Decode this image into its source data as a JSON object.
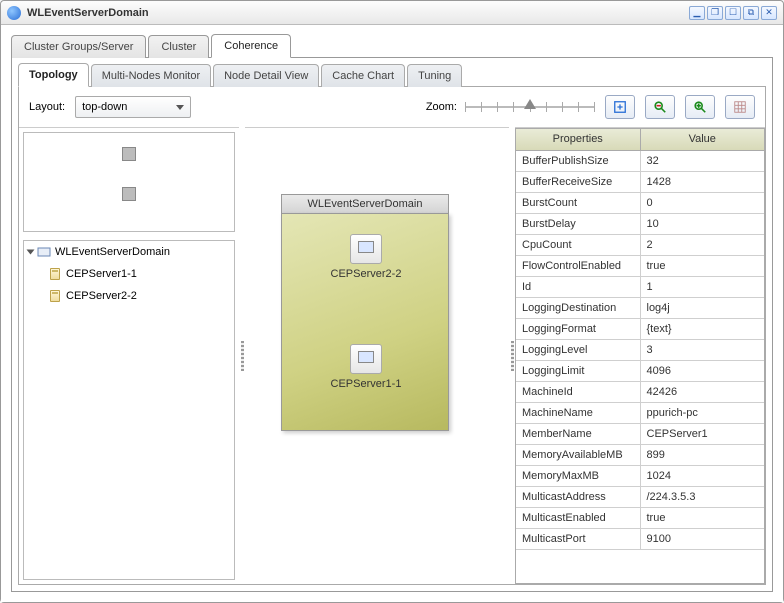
{
  "window": {
    "title": "WLEventServerDomain"
  },
  "primary_tabs": [
    {
      "label": "Cluster Groups/Server"
    },
    {
      "label": "Cluster"
    },
    {
      "label": "Coherence",
      "active": true
    }
  ],
  "sub_tabs": [
    {
      "label": "Topology",
      "active": true
    },
    {
      "label": "Multi-Nodes Monitor"
    },
    {
      "label": "Node Detail View"
    },
    {
      "label": "Cache Chart"
    },
    {
      "label": "Tuning"
    }
  ],
  "layout": {
    "label": "Layout:",
    "value": "top-down"
  },
  "zoom": {
    "label": "Zoom:"
  },
  "tree": {
    "root": "WLEventServerDomain",
    "children": [
      "CEPServer1-1",
      "CEPServer2-2"
    ]
  },
  "canvas": {
    "domain_label": "WLEventServerDomain",
    "nodes": [
      "CEPServer2-2",
      "CEPServer1-1"
    ]
  },
  "properties": {
    "header": {
      "key": "Properties",
      "value": "Value"
    },
    "rows": [
      {
        "k": "BufferPublishSize",
        "v": "32"
      },
      {
        "k": "BufferReceiveSize",
        "v": "1428"
      },
      {
        "k": "BurstCount",
        "v": "0"
      },
      {
        "k": "BurstDelay",
        "v": "10"
      },
      {
        "k": "CpuCount",
        "v": "2"
      },
      {
        "k": "FlowControlEnabled",
        "v": "true"
      },
      {
        "k": "Id",
        "v": "1"
      },
      {
        "k": "LoggingDestination",
        "v": "log4j"
      },
      {
        "k": "LoggingFormat",
        "v": "{text}"
      },
      {
        "k": "LoggingLevel",
        "v": "3"
      },
      {
        "k": "LoggingLimit",
        "v": "4096"
      },
      {
        "k": "MachineId",
        "v": "42426"
      },
      {
        "k": "MachineName",
        "v": "ppurich-pc"
      },
      {
        "k": "MemberName",
        "v": "CEPServer1"
      },
      {
        "k": "MemoryAvailableMB",
        "v": "899"
      },
      {
        "k": "MemoryMaxMB",
        "v": "1024"
      },
      {
        "k": "MulticastAddress",
        "v": "/224.3.5.3"
      },
      {
        "k": "MulticastEnabled",
        "v": "true"
      },
      {
        "k": "MulticastPort",
        "v": "9100"
      }
    ]
  }
}
